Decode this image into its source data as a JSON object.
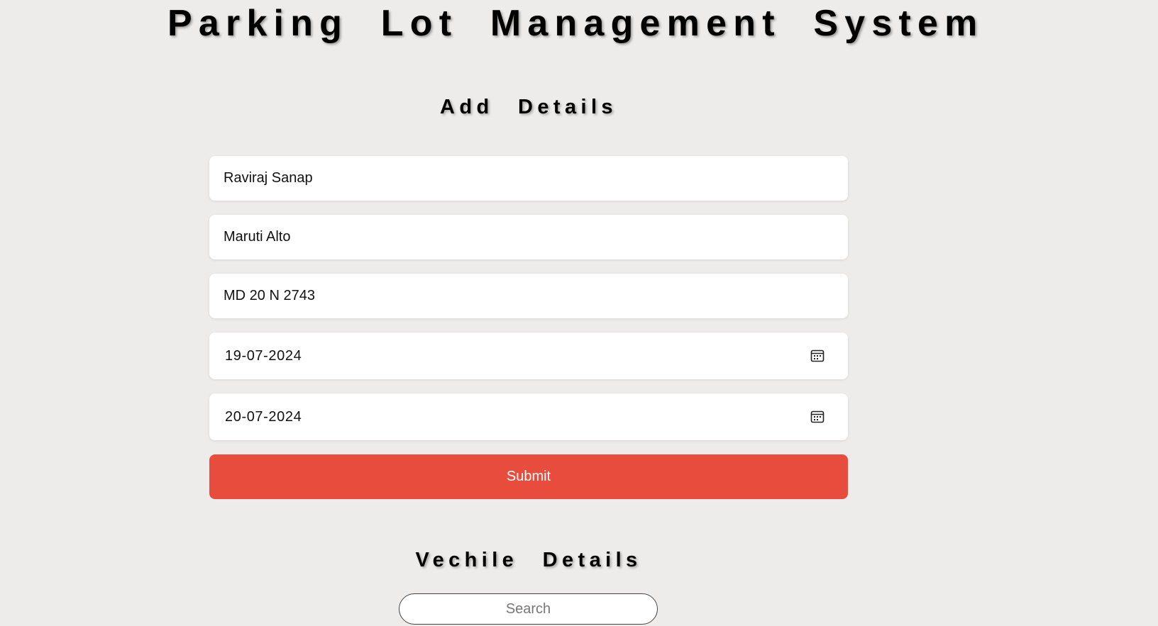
{
  "header": {
    "title": "Parking Lot Management System"
  },
  "add_section": {
    "heading": "Add Details",
    "fields": {
      "owner_name": "Raviraj Sanap",
      "vehicle_model": "Maruti Alto",
      "vehicle_number": "MD 20 N 2743",
      "entry_date": "19-07-2024",
      "exit_date": "20-07-2024"
    },
    "submit_label": "Submit"
  },
  "vehicle_section": {
    "heading": "Vechile Details",
    "search_placeholder": "Search"
  },
  "icons": {
    "date_picker": "calendar-icon"
  },
  "colors": {
    "background": "#eeecea",
    "submit_button": "#e74c3c",
    "field_background": "#ffffff"
  }
}
